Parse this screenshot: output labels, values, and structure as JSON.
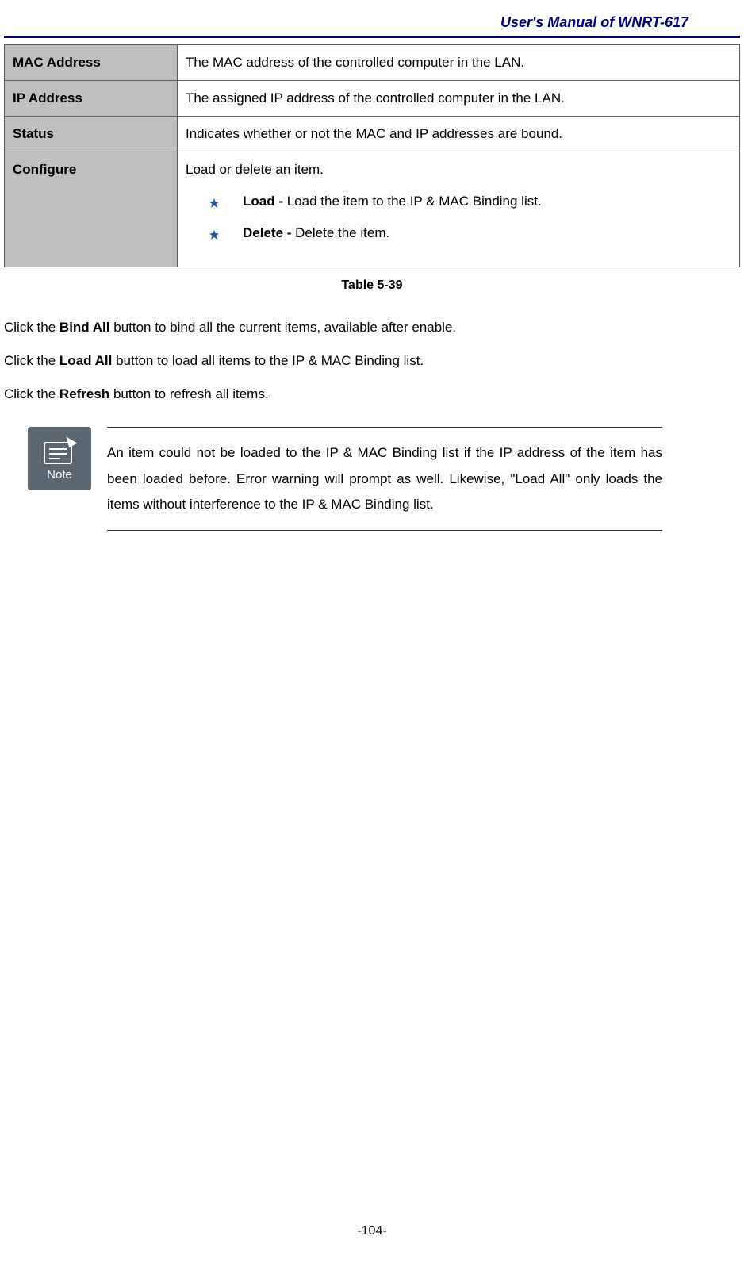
{
  "header": {
    "title": "User's Manual of WNRT-617"
  },
  "table": {
    "rows": [
      {
        "label": "MAC Address",
        "desc": "The MAC address of the controlled computer in the LAN."
      },
      {
        "label": "IP Address",
        "desc": "The assigned IP address of the controlled computer in the LAN."
      },
      {
        "label": "Status",
        "desc": "Indicates whether or not the MAC and IP addresses are bound."
      },
      {
        "label": "Configure",
        "desc": "Load or delete an item.",
        "bullets": [
          {
            "bold": "Load - ",
            "rest": "Load the item to the IP & MAC Binding list."
          },
          {
            "bold": "Delete - ",
            "rest": "Delete the item."
          }
        ]
      }
    ],
    "caption": "Table 5-39"
  },
  "paragraphs": {
    "p1_pre": "Click the ",
    "p1_bold": "Bind All",
    "p1_post": " button to bind all the current items, available after enable.",
    "p2_pre": "Click the ",
    "p2_bold": "Load All",
    "p2_post": " button to load all items to the IP & MAC Binding list.",
    "p3_pre": "Click the ",
    "p3_bold": "Refresh",
    "p3_post": " button to refresh all items."
  },
  "note": {
    "label": "Note",
    "text": "An item could not be loaded to the IP & MAC Binding list if the IP address of the item has been loaded before. Error warning will prompt as well. Likewise, \"Load All\" only loads the items without interference to the IP & MAC Binding list."
  },
  "footer": {
    "page_number": "-104-"
  }
}
